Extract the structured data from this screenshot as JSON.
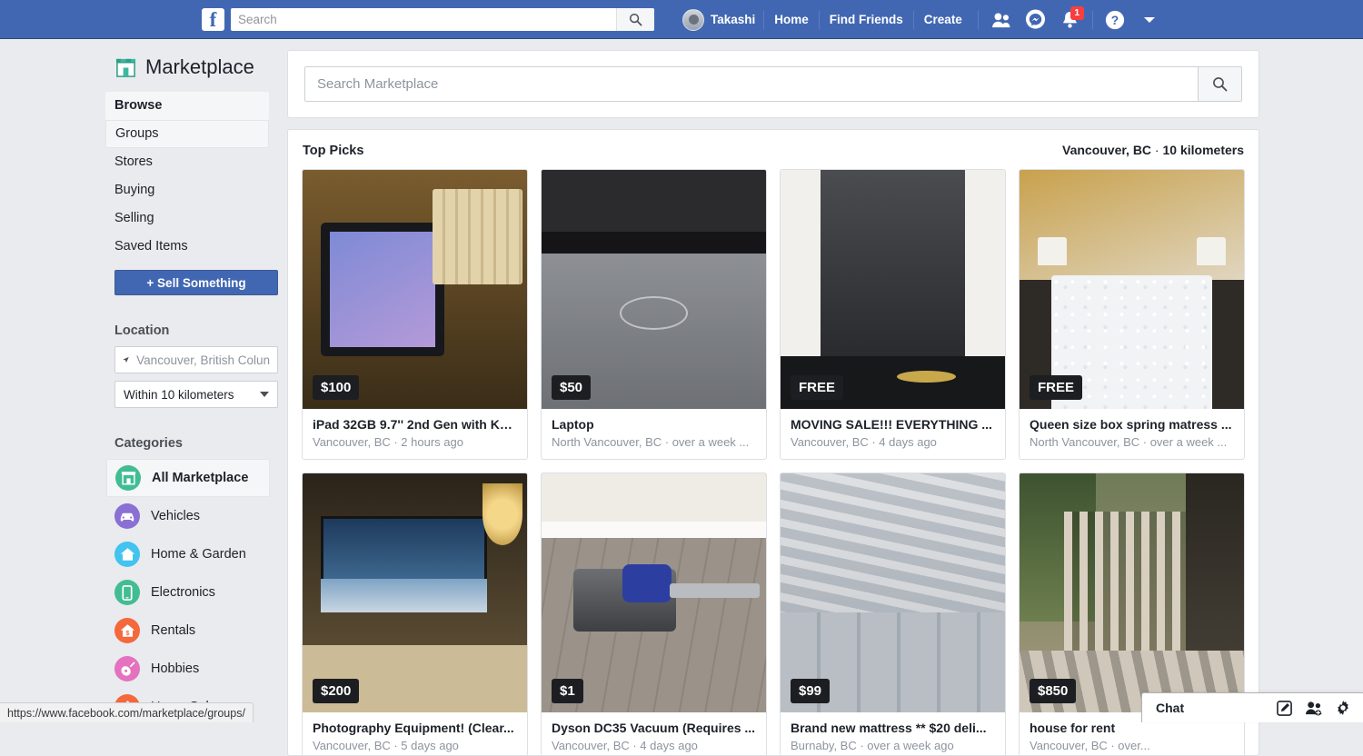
{
  "topnav": {
    "logo": "f",
    "search_placeholder": "Search",
    "search_value": "",
    "search_icon": "search-icon",
    "profile_name": "Takashi",
    "links": [
      "Home",
      "Find Friends",
      "Create"
    ],
    "icons": [
      "friend-requests-icon",
      "messenger-icon",
      "notifications-icon",
      "help-icon",
      "account-chevron-icon"
    ],
    "notification_count": "1",
    "bg_color": "#4267b2"
  },
  "sidebar": {
    "title": "Marketplace",
    "title_icon": "storefront-icon",
    "nav_items": [
      {
        "label": "Browse",
        "state": "active"
      },
      {
        "label": "Groups",
        "state": "hovered"
      },
      {
        "label": "Stores",
        "state": "normal"
      },
      {
        "label": "Buying",
        "state": "normal"
      },
      {
        "label": "Selling",
        "state": "normal"
      },
      {
        "label": "Saved Items",
        "state": "normal"
      }
    ],
    "sell_button": "+ Sell Something",
    "location_heading": "Location",
    "location_value": "Vancouver, British Colun",
    "location_icon": "location-arrow-icon",
    "distance_value": "Within 10 kilometers",
    "distance_icon": "chevron-down-icon",
    "categories_heading": "Categories",
    "categories": [
      {
        "label": "All Marketplace",
        "icon": "storefront-icon",
        "color": "#42bd93",
        "state": "active"
      },
      {
        "label": "Vehicles",
        "icon": "car-icon",
        "color": "#8a6fd4",
        "state": "normal"
      },
      {
        "label": "Home & Garden",
        "icon": "house-icon",
        "color": "#43c3ef",
        "state": "normal"
      },
      {
        "label": "Electronics",
        "icon": "phone-icon",
        "color": "#42bd93",
        "state": "normal"
      },
      {
        "label": "Rentals",
        "icon": "rental-house-icon",
        "color": "#f4683c",
        "state": "normal"
      },
      {
        "label": "Hobbies",
        "icon": "guitar-icon",
        "color": "#e472be",
        "state": "normal"
      },
      {
        "label": "Home Sales",
        "icon": "home-sales-icon",
        "color": "#f4683c",
        "state": "normal"
      }
    ]
  },
  "marketplace_search": {
    "placeholder": "Search Marketplace",
    "value": "",
    "icon": "search-icon"
  },
  "top_picks": {
    "title": "Top Picks",
    "location_city": "Vancouver, BC",
    "location_sep": " · ",
    "location_radius": "10 kilometers",
    "items": [
      {
        "price": "$100",
        "title": "iPad 32GB 9.7'' 2nd Gen with Ke...",
        "meta": "Vancouver, BC · 2 hours ago",
        "photo": "ipad-keyboard"
      },
      {
        "price": "$50",
        "title": "Laptop",
        "meta": "North Vancouver, BC · over a week ...",
        "photo": "dell-laptop"
      },
      {
        "price": "FREE",
        "title": "MOVING SALE!!! EVERYTHING ...",
        "meta": "Vancouver, BC · 4 days ago",
        "photo": "moving-sale-tv"
      },
      {
        "price": "FREE",
        "title": "Queen size box spring matress ...",
        "meta": "North Vancouver, BC · over a week ...",
        "photo": "bedroom-mattress"
      },
      {
        "price": "$200",
        "title": "Photography Equipment! (Clear...",
        "meta": "Vancouver, BC · 5 days ago",
        "photo": "tv-chandelier-room"
      },
      {
        "price": "$1",
        "title": "Dyson DC35 Vacuum (Requires ...",
        "meta": "Vancouver, BC · 4 days ago",
        "photo": "dyson-vacuum"
      },
      {
        "price": "$99",
        "title": "Brand new mattress ** $20 deli...",
        "meta": "Burnaby, BC · over a week ago",
        "photo": "wrapped-mattresses"
      },
      {
        "price": "$850",
        "title": "house for rent",
        "meta": "Vancouver, BC · over...",
        "photo": "house-balcony"
      }
    ]
  },
  "chatbar": {
    "label": "Chat",
    "icons": [
      "compose-icon",
      "add-people-icon",
      "settings-gear-icon"
    ]
  },
  "statusbar": {
    "url": "https://www.facebook.com/marketplace/groups/"
  }
}
